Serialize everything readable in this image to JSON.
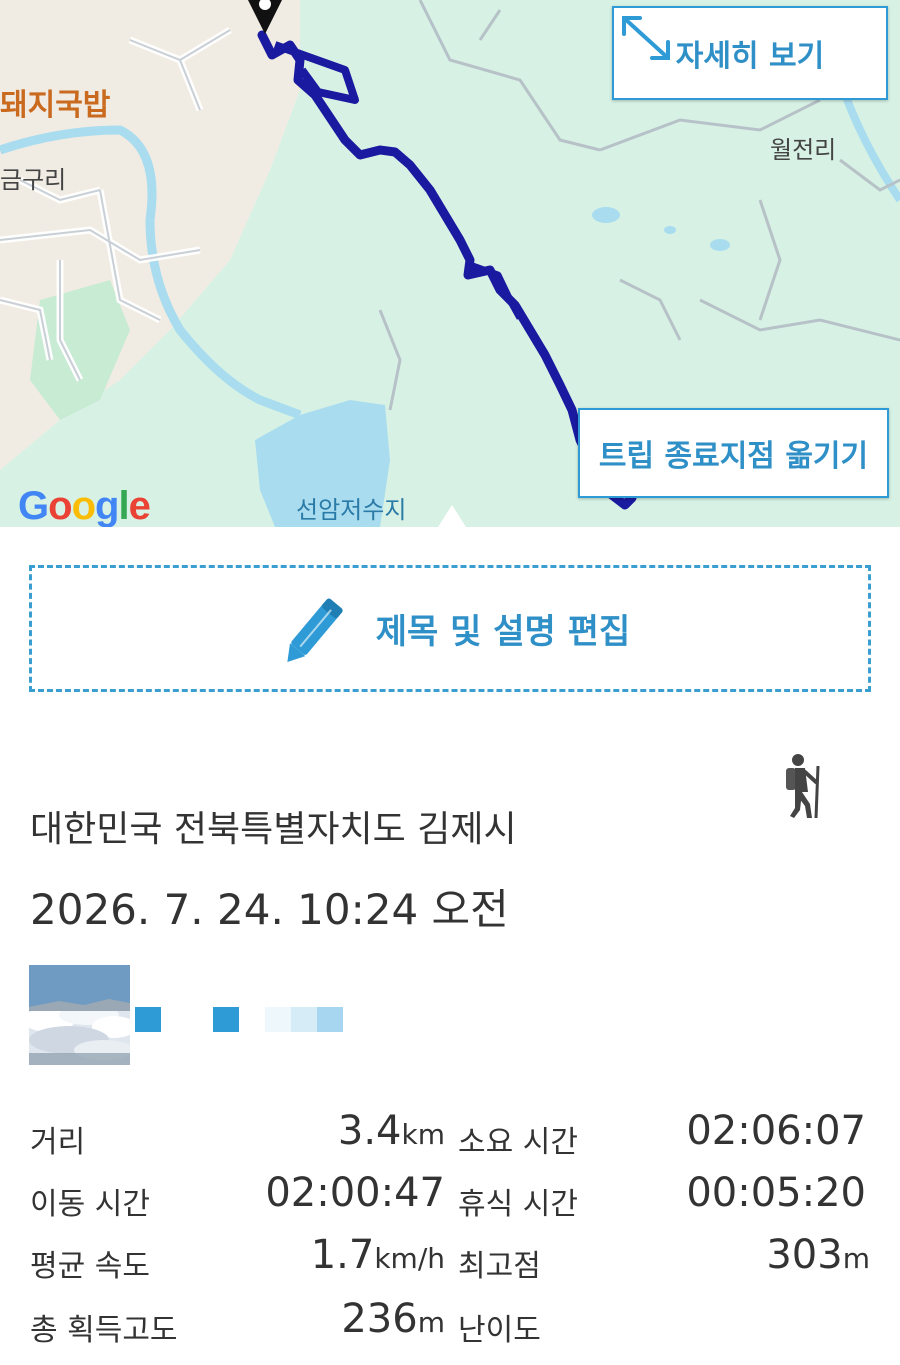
{
  "map": {
    "labels": {
      "restaurant": "돼지국밥",
      "village_left": "금구리",
      "village_right": "월전리",
      "reservoir": "선암저수지"
    },
    "logo": "Google",
    "buttons": {
      "detail_view": "자세히 보기",
      "move_trip_end": "트립 종료지점 옮기기"
    },
    "colors": {
      "route": "#1a1aa0",
      "forest": "#d7f2e4",
      "water": "#a9dcef",
      "accent": "#2f9bd6"
    }
  },
  "edit": {
    "label": "제목 및 설명 편집"
  },
  "trip": {
    "activity_icon": "hiker-icon",
    "location": "대한민국 전북특별자치도 김제시",
    "datetime": "2026. 7. 24. 10:24 오전"
  },
  "stats": {
    "distance": {
      "label": "거리",
      "value": "3.4",
      "unit": "km"
    },
    "total_time": {
      "label": "소요 시간",
      "value": "02:06:07"
    },
    "moving_time": {
      "label": "이동 시간",
      "value": "02:00:47"
    },
    "rest_time": {
      "label": "휴식 시간",
      "value": "00:05:20"
    },
    "avg_speed": {
      "label": "평균 속도",
      "value": "1.7",
      "unit": "km/h"
    },
    "highest_point": {
      "label": "최고점",
      "value": "303",
      "unit": "m"
    },
    "total_ascent": {
      "label": "총 획득고도",
      "value": "236",
      "unit": "m"
    },
    "difficulty": {
      "label": "난이도"
    }
  }
}
